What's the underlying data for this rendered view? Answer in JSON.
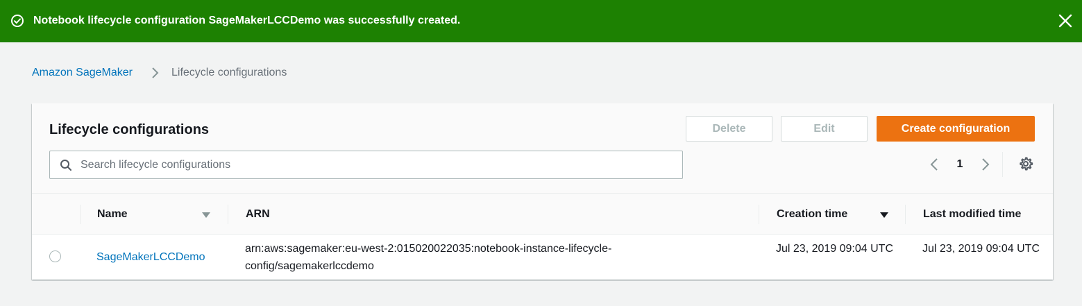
{
  "flash": {
    "message": "Notebook lifecycle configuration SageMakerLCCDemo was successfully created.",
    "status_icon": "success-check-circle-icon",
    "close_icon": "close-icon",
    "color": "#1d8102"
  },
  "breadcrumb": {
    "items": [
      "Amazon SageMaker",
      "Lifecycle configurations"
    ]
  },
  "panel": {
    "title": "Lifecycle configurations",
    "buttons": {
      "delete": "Delete",
      "edit": "Edit",
      "create": "Create configuration"
    },
    "accent_color": "#ec7211",
    "search": {
      "placeholder": "Search lifecycle configurations",
      "value": ""
    },
    "pagination": {
      "current_page": "1"
    }
  },
  "table": {
    "columns": [
      "Name",
      "ARN",
      "Creation time",
      "Last modified time"
    ],
    "rows": [
      {
        "name": "SageMakerLCCDemo",
        "arn": "arn:aws:sagemaker:eu-west-2:015020022035:notebook-instance-lifecycle-config/sagemakerlccdemo",
        "creation_time": "Jul 23, 2019 09:04 UTC",
        "last_modified_time": "Jul 23, 2019 09:04 UTC",
        "selected": false
      }
    ]
  }
}
